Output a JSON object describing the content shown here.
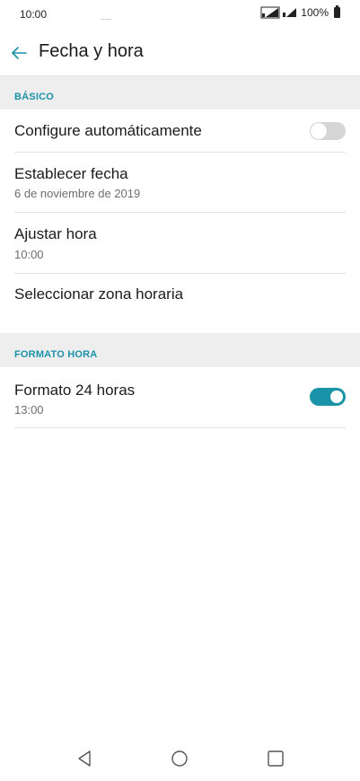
{
  "status_bar": {
    "time": "10:00",
    "battery_percent": "100%"
  },
  "app_bar": {
    "title": "Fecha y hora"
  },
  "sections": {
    "basic": {
      "label": "BÁSICO",
      "rows": {
        "auto_config": {
          "title": "Configure automáticamente",
          "toggle_on": false
        },
        "set_date": {
          "title": "Establecer fecha",
          "subtitle": "6 de noviembre de 2019"
        },
        "set_time": {
          "title": "Ajustar hora",
          "subtitle": "10:00"
        },
        "time_zone": {
          "title": "Seleccionar zona horaria"
        }
      }
    },
    "time_format": {
      "label": "FORMATO HORA",
      "rows": {
        "format_24h": {
          "title": "Formato 24 horas",
          "subtitle": "13:00",
          "toggle_on": true
        }
      }
    }
  },
  "colors": {
    "accent": "#1a93a8",
    "section_bg": "#eeeeee",
    "toggle_off": "#d6d6d6"
  },
  "icons": {
    "back": "arrow-left-icon",
    "nav_back": "triangle-back-icon",
    "nav_home": "circle-home-icon",
    "nav_recents": "square-recents-icon"
  }
}
